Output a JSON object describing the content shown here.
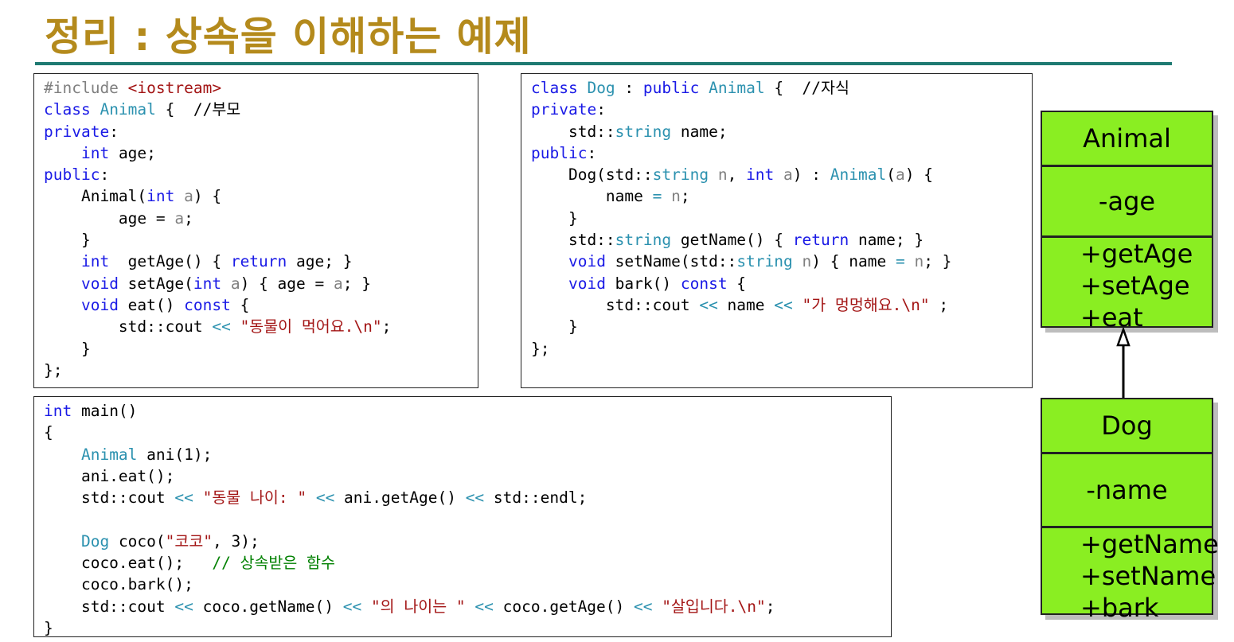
{
  "slide": {
    "title": "정리 : 상속을 이해하는 예제"
  },
  "code_animal": [
    [
      {
        "t": "#include ",
        "c": "pp"
      },
      {
        "t": "<iostream>",
        "c": "st"
      }
    ],
    [
      {
        "t": "class ",
        "c": "kw"
      },
      {
        "t": "Animal",
        "c": "ty"
      },
      {
        "t": " {  //부모",
        "c": ""
      }
    ],
    [
      {
        "t": "private",
        "c": "kw"
      },
      {
        "t": ":",
        "c": ""
      }
    ],
    [
      {
        "t": "    ",
        "c": ""
      },
      {
        "t": "int",
        "c": "kw"
      },
      {
        "t": " age;",
        "c": ""
      }
    ],
    [
      {
        "t": "public",
        "c": "kw"
      },
      {
        "t": ":",
        "c": ""
      }
    ],
    [
      {
        "t": "    Animal(",
        "c": ""
      },
      {
        "t": "int",
        "c": "kw"
      },
      {
        "t": " ",
        "c": ""
      },
      {
        "t": "a",
        "c": "gy"
      },
      {
        "t": ") {",
        "c": ""
      }
    ],
    [
      {
        "t": "        age = ",
        "c": ""
      },
      {
        "t": "a",
        "c": "gy"
      },
      {
        "t": ";",
        "c": ""
      }
    ],
    [
      {
        "t": "    }",
        "c": ""
      }
    ],
    [
      {
        "t": "    ",
        "c": ""
      },
      {
        "t": "int",
        "c": "kw"
      },
      {
        "t": "  getAge() { ",
        "c": ""
      },
      {
        "t": "return",
        "c": "kw"
      },
      {
        "t": " age; }",
        "c": ""
      }
    ],
    [
      {
        "t": "    ",
        "c": ""
      },
      {
        "t": "void",
        "c": "kw"
      },
      {
        "t": " setAge(",
        "c": ""
      },
      {
        "t": "int",
        "c": "kw"
      },
      {
        "t": " ",
        "c": ""
      },
      {
        "t": "a",
        "c": "gy"
      },
      {
        "t": ") { age = ",
        "c": ""
      },
      {
        "t": "a",
        "c": "gy"
      },
      {
        "t": "; }",
        "c": ""
      }
    ],
    [
      {
        "t": "    ",
        "c": ""
      },
      {
        "t": "void",
        "c": "kw"
      },
      {
        "t": " eat() ",
        "c": ""
      },
      {
        "t": "const",
        "c": "kw"
      },
      {
        "t": " {",
        "c": ""
      }
    ],
    [
      {
        "t": "        std::cout ",
        "c": ""
      },
      {
        "t": "<<",
        "c": "ty"
      },
      {
        "t": " ",
        "c": ""
      },
      {
        "t": "\"동물이 먹어요.\\n\"",
        "c": "st"
      },
      {
        "t": ";",
        "c": ""
      }
    ],
    [
      {
        "t": "    }",
        "c": ""
      }
    ],
    [
      {
        "t": "};",
        "c": ""
      }
    ]
  ],
  "code_dog": [
    [
      {
        "t": "class ",
        "c": "kw"
      },
      {
        "t": "Dog",
        "c": "ty"
      },
      {
        "t": " : ",
        "c": ""
      },
      {
        "t": "public",
        "c": "kw"
      },
      {
        "t": " ",
        "c": ""
      },
      {
        "t": "Animal",
        "c": "ty"
      },
      {
        "t": " {  //자식",
        "c": ""
      }
    ],
    [
      {
        "t": "private",
        "c": "kw"
      },
      {
        "t": ":",
        "c": ""
      }
    ],
    [
      {
        "t": "    std::",
        "c": ""
      },
      {
        "t": "string",
        "c": "ty"
      },
      {
        "t": " name;",
        "c": ""
      }
    ],
    [
      {
        "t": "public",
        "c": "kw"
      },
      {
        "t": ":",
        "c": ""
      }
    ],
    [
      {
        "t": "    Dog(std::",
        "c": ""
      },
      {
        "t": "string",
        "c": "ty"
      },
      {
        "t": " ",
        "c": ""
      },
      {
        "t": "n",
        "c": "gy"
      },
      {
        "t": ", ",
        "c": ""
      },
      {
        "t": "int",
        "c": "kw"
      },
      {
        "t": " ",
        "c": ""
      },
      {
        "t": "a",
        "c": "gy"
      },
      {
        "t": ") : ",
        "c": ""
      },
      {
        "t": "Animal",
        "c": "ty"
      },
      {
        "t": "(",
        "c": ""
      },
      {
        "t": "a",
        "c": "gy"
      },
      {
        "t": ") {",
        "c": ""
      }
    ],
    [
      {
        "t": "        name ",
        "c": ""
      },
      {
        "t": "=",
        "c": "ty"
      },
      {
        "t": " ",
        "c": ""
      },
      {
        "t": "n",
        "c": "gy"
      },
      {
        "t": ";",
        "c": ""
      }
    ],
    [
      {
        "t": "    }",
        "c": ""
      }
    ],
    [
      {
        "t": "    std::",
        "c": ""
      },
      {
        "t": "string",
        "c": "ty"
      },
      {
        "t": " getName() { ",
        "c": ""
      },
      {
        "t": "return",
        "c": "kw"
      },
      {
        "t": " name; }",
        "c": ""
      }
    ],
    [
      {
        "t": "    ",
        "c": ""
      },
      {
        "t": "void",
        "c": "kw"
      },
      {
        "t": " setName(std::",
        "c": ""
      },
      {
        "t": "string",
        "c": "ty"
      },
      {
        "t": " ",
        "c": ""
      },
      {
        "t": "n",
        "c": "gy"
      },
      {
        "t": ") { name ",
        "c": ""
      },
      {
        "t": "=",
        "c": "ty"
      },
      {
        "t": " ",
        "c": ""
      },
      {
        "t": "n",
        "c": "gy"
      },
      {
        "t": "; }",
        "c": ""
      }
    ],
    [
      {
        "t": "    ",
        "c": ""
      },
      {
        "t": "void",
        "c": "kw"
      },
      {
        "t": " bark() ",
        "c": ""
      },
      {
        "t": "const",
        "c": "kw"
      },
      {
        "t": " {",
        "c": ""
      }
    ],
    [
      {
        "t": "        std::cout ",
        "c": ""
      },
      {
        "t": "<<",
        "c": "ty"
      },
      {
        "t": " name ",
        "c": ""
      },
      {
        "t": "<<",
        "c": "ty"
      },
      {
        "t": " ",
        "c": ""
      },
      {
        "t": "\"가 멍멍해요.\\n\"",
        "c": "st"
      },
      {
        "t": " ;",
        "c": ""
      }
    ],
    [
      {
        "t": "    }",
        "c": ""
      }
    ],
    [
      {
        "t": "};",
        "c": ""
      }
    ]
  ],
  "code_main": [
    [
      {
        "t": "int",
        "c": "kw"
      },
      {
        "t": " main()",
        "c": ""
      }
    ],
    [
      {
        "t": "{",
        "c": ""
      }
    ],
    [
      {
        "t": "    ",
        "c": ""
      },
      {
        "t": "Animal",
        "c": "ty"
      },
      {
        "t": " ani(1);",
        "c": ""
      }
    ],
    [
      {
        "t": "    ani.eat();",
        "c": ""
      }
    ],
    [
      {
        "t": "    std::cout ",
        "c": ""
      },
      {
        "t": "<<",
        "c": "ty"
      },
      {
        "t": " ",
        "c": ""
      },
      {
        "t": "\"동물 나이: \"",
        "c": "st"
      },
      {
        "t": " ",
        "c": ""
      },
      {
        "t": "<<",
        "c": "ty"
      },
      {
        "t": " ani.getAge() ",
        "c": ""
      },
      {
        "t": "<<",
        "c": "ty"
      },
      {
        "t": " std::endl;",
        "c": ""
      }
    ],
    [
      {
        "t": "",
        "c": ""
      }
    ],
    [
      {
        "t": "    ",
        "c": ""
      },
      {
        "t": "Dog",
        "c": "ty"
      },
      {
        "t": " coco(",
        "c": ""
      },
      {
        "t": "\"코코\"",
        "c": "st"
      },
      {
        "t": ", 3);",
        "c": ""
      }
    ],
    [
      {
        "t": "    coco.eat();   ",
        "c": ""
      },
      {
        "t": "// 상속받은 함수",
        "c": "cm"
      }
    ],
    [
      {
        "t": "    coco.bark();",
        "c": ""
      }
    ],
    [
      {
        "t": "    std::cout ",
        "c": ""
      },
      {
        "t": "<<",
        "c": "ty"
      },
      {
        "t": " coco.getName() ",
        "c": ""
      },
      {
        "t": "<<",
        "c": "ty"
      },
      {
        "t": " ",
        "c": ""
      },
      {
        "t": "\"의 나이는 \"",
        "c": "st"
      },
      {
        "t": " ",
        "c": ""
      },
      {
        "t": "<<",
        "c": "ty"
      },
      {
        "t": " coco.getAge() ",
        "c": ""
      },
      {
        "t": "<<",
        "c": "ty"
      },
      {
        "t": " ",
        "c": ""
      },
      {
        "t": "\"살입니다.\\n\"",
        "c": "st"
      },
      {
        "t": ";",
        "c": ""
      }
    ],
    [
      {
        "t": "}",
        "c": ""
      }
    ]
  ],
  "uml": {
    "animal": {
      "name": "Animal",
      "attr": "-age",
      "ops": [
        "+getAge",
        "+setAge",
        "+eat"
      ]
    },
    "dog": {
      "name": "Dog",
      "attr": "-name",
      "ops": [
        "+getName",
        "+setName",
        "+bark"
      ]
    }
  },
  "colors": {
    "title": "#b48a1c",
    "rule": "#1f7a72",
    "uml_fill": "#8aee22",
    "keyword": "#1a1ae6",
    "type": "#2b91af",
    "string": "#a31515",
    "comment": "#008000"
  }
}
